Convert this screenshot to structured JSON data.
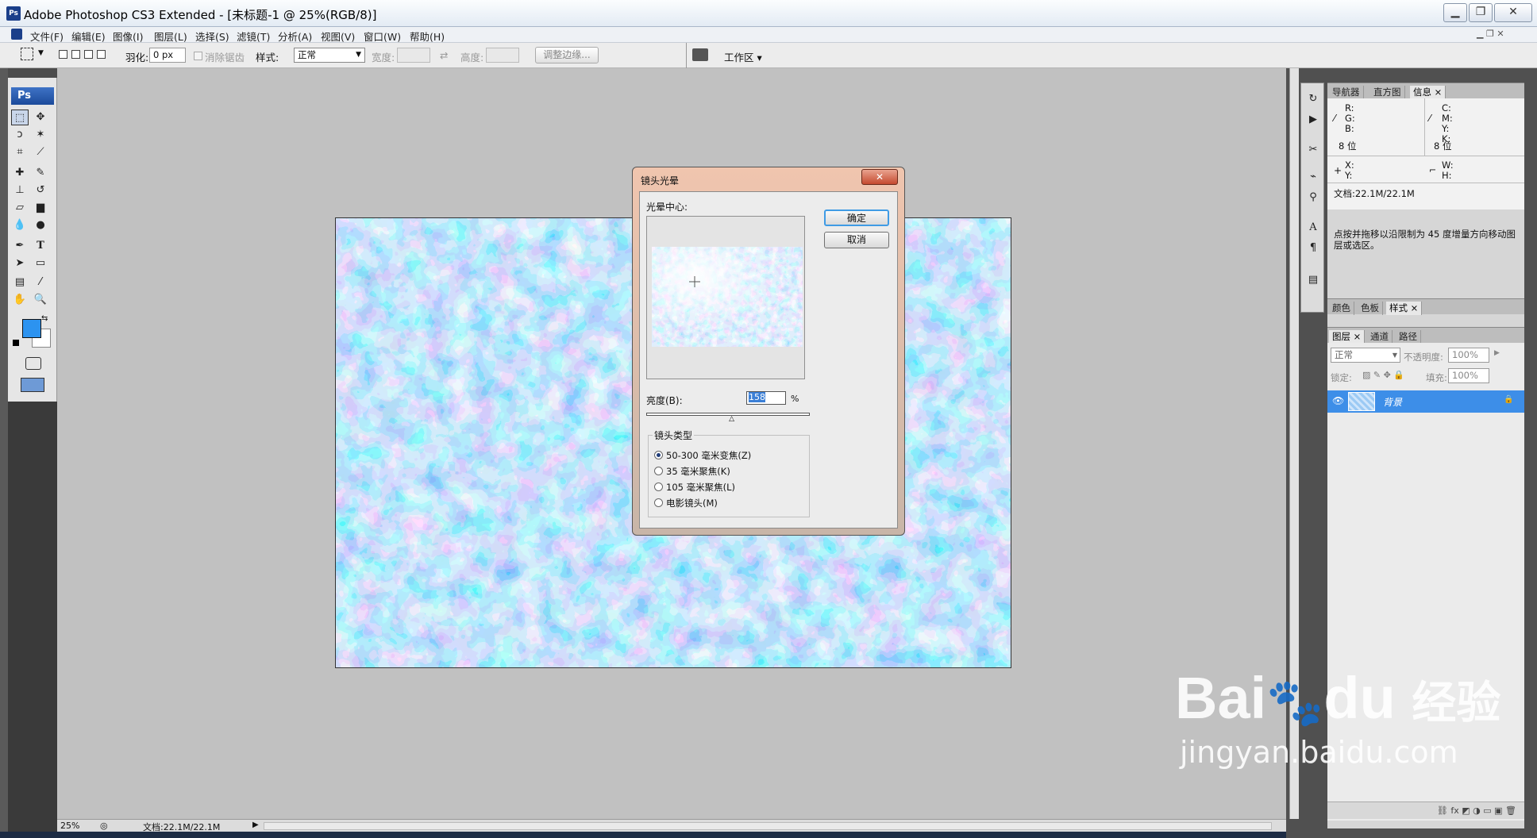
{
  "window": {
    "title": "Adobe Photoshop CS3 Extended - [未标题-1 @ 25%(RGB/8)]",
    "app_icon": "Ps",
    "controls": [
      "minimize-icon",
      "restore-icon",
      "close-icon"
    ]
  },
  "menu": [
    "文件(F)",
    "编辑(E)",
    "图像(I)",
    "图层(L)",
    "选择(S)",
    "滤镜(T)",
    "分析(A)",
    "视图(V)",
    "窗口(W)",
    "帮助(H)"
  ],
  "options": {
    "feather_label": "羽化:",
    "feather_value": "0 px",
    "antialias_label": "消除锯齿",
    "style_label": "样式:",
    "style_value": "正常",
    "width_label": "宽度:",
    "height_label": "高度:",
    "refine_button": "调整边缘...",
    "workspace_button": "工作区"
  },
  "toolbox": {
    "logo": "Ps",
    "tools": [
      "marquee-icon",
      "move-icon",
      "lasso-icon",
      "magic-wand-icon",
      "crop-icon",
      "slice-icon",
      "healing-icon",
      "brush-icon",
      "stamp-icon",
      "history-brush-icon",
      "eraser-icon",
      "gradient-icon",
      "blur-icon",
      "dodge-icon",
      "pen-icon",
      "type-icon",
      "path-select-icon",
      "shape-icon",
      "notes-icon",
      "eyedropper-icon",
      "hand-icon",
      "zoom-icon"
    ],
    "foreground_color": "#2c93f0",
    "background_color": "#ffffff"
  },
  "status": {
    "zoom": "25%",
    "doc_size": "文档:22.1M/22.1M"
  },
  "dialog": {
    "title": "镜头光晕",
    "ok": "确定",
    "cancel": "取消",
    "center_label": "光晕中心:",
    "brightness_label": "亮度(B):",
    "brightness_value": "158",
    "percent": "%",
    "brightness_fraction": 0.53,
    "lens_group_label": "镜头类型",
    "lens_types": [
      {
        "label": "50-300 毫米变焦(Z)",
        "selected": true
      },
      {
        "label": "35 毫米聚焦(K)",
        "selected": false
      },
      {
        "label": "105 毫米聚焦(L)",
        "selected": false
      },
      {
        "label": "电影镜头(M)",
        "selected": false
      }
    ]
  },
  "panels": {
    "info_tabs": [
      "导航器",
      "直方图",
      "信息"
    ],
    "info": {
      "rgb": [
        "R:",
        "G:",
        "B:"
      ],
      "cmyk": [
        "C:",
        "M:",
        "Y:",
        "K:"
      ],
      "bits_left": "8 位",
      "bits_right": "8 位",
      "xy": [
        "X:",
        "Y:"
      ],
      "wh": [
        "W:",
        "H:"
      ],
      "doc": "文档:22.1M/22.1M",
      "hint": "点按并拖移以沿限制为 45 度增量方向移动图层或选区。"
    },
    "color_tabs": [
      "颜色",
      "色板",
      "样式"
    ],
    "layer_tabs": [
      "图层",
      "通道",
      "路径"
    ],
    "layers": {
      "blend_mode": "正常",
      "opacity_label": "不透明度:",
      "opacity_value": "100%",
      "lock_label": "锁定:",
      "fill_label": "填充:",
      "fill_value": "100%",
      "items": [
        {
          "name": "背景",
          "locked": true,
          "visible": true
        }
      ]
    }
  },
  "watermark": {
    "brand": "Bai",
    "brand2": "du",
    "cn": "经验",
    "url": "jingyan.baidu.com"
  }
}
